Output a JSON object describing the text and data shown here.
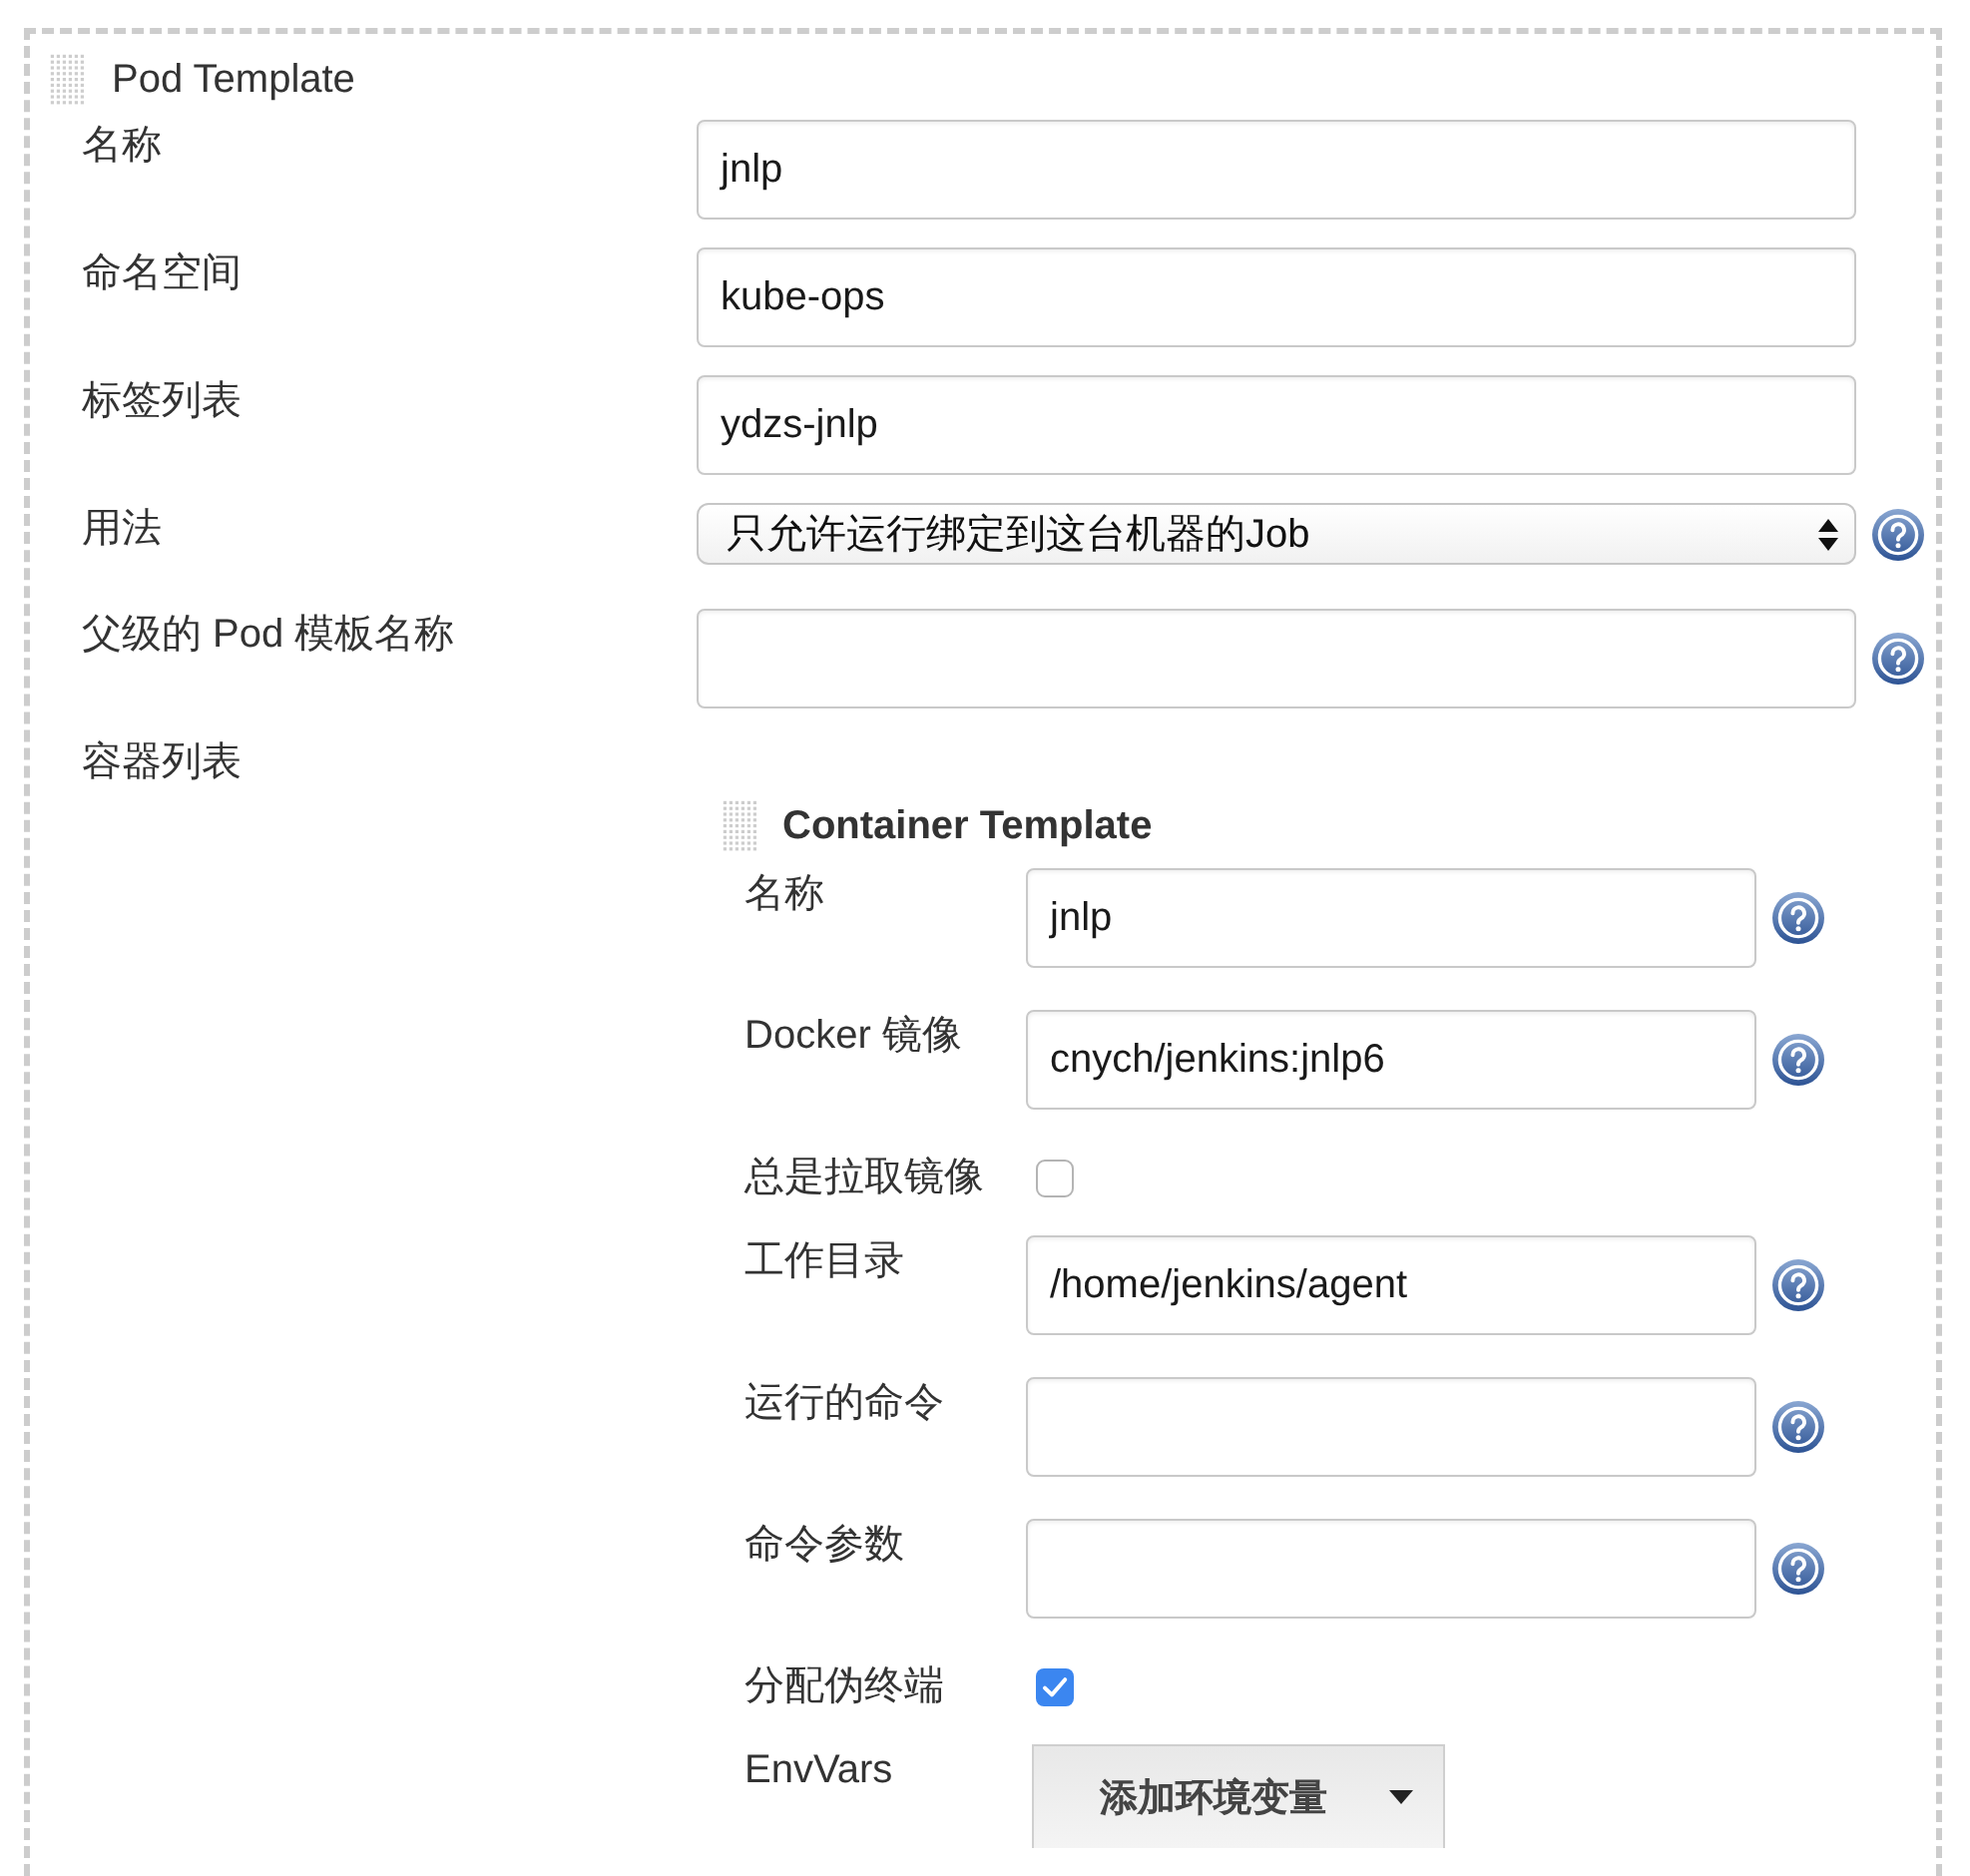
{
  "pod_template": {
    "title": "Pod Template",
    "fields": [
      {
        "kind": "text",
        "label": "名称",
        "value": "jnlp",
        "help": false
      },
      {
        "kind": "text",
        "label": "命名空间",
        "value": "kube-ops",
        "help": false
      },
      {
        "kind": "text",
        "label": "标签列表",
        "value": "ydzs-jnlp",
        "help": false
      },
      {
        "kind": "select",
        "label": "用法",
        "value": "只允许运行绑定到这台机器的Job",
        "help": true
      },
      {
        "kind": "text",
        "label": "父级的 Pod 模板名称",
        "help": true
      }
    ],
    "container_list": {
      "label": "容器列表",
      "template": {
        "title": "Container Template",
        "fields": [
          {
            "kind": "text",
            "label": "名称",
            "value": "jnlp",
            "help": true
          },
          {
            "kind": "text",
            "label": "Docker 镜像",
            "value": "cnych/jenkins:jnlp6",
            "help": true
          },
          {
            "kind": "checkbox",
            "label": "总是拉取镜像",
            "checked": false
          },
          {
            "kind": "text",
            "label": "工作目录",
            "value": "/home/jenkins/agent",
            "help": true
          },
          {
            "kind": "text",
            "label": "运行的命令",
            "help": true
          },
          {
            "kind": "text",
            "label": "命令参数",
            "help": true
          },
          {
            "kind": "checkbox",
            "label": "分配伪终端",
            "checked": true
          },
          {
            "kind": "dropdown_button",
            "label": "EnvVars",
            "button": "添加环境变量"
          }
        ]
      }
    }
  }
}
